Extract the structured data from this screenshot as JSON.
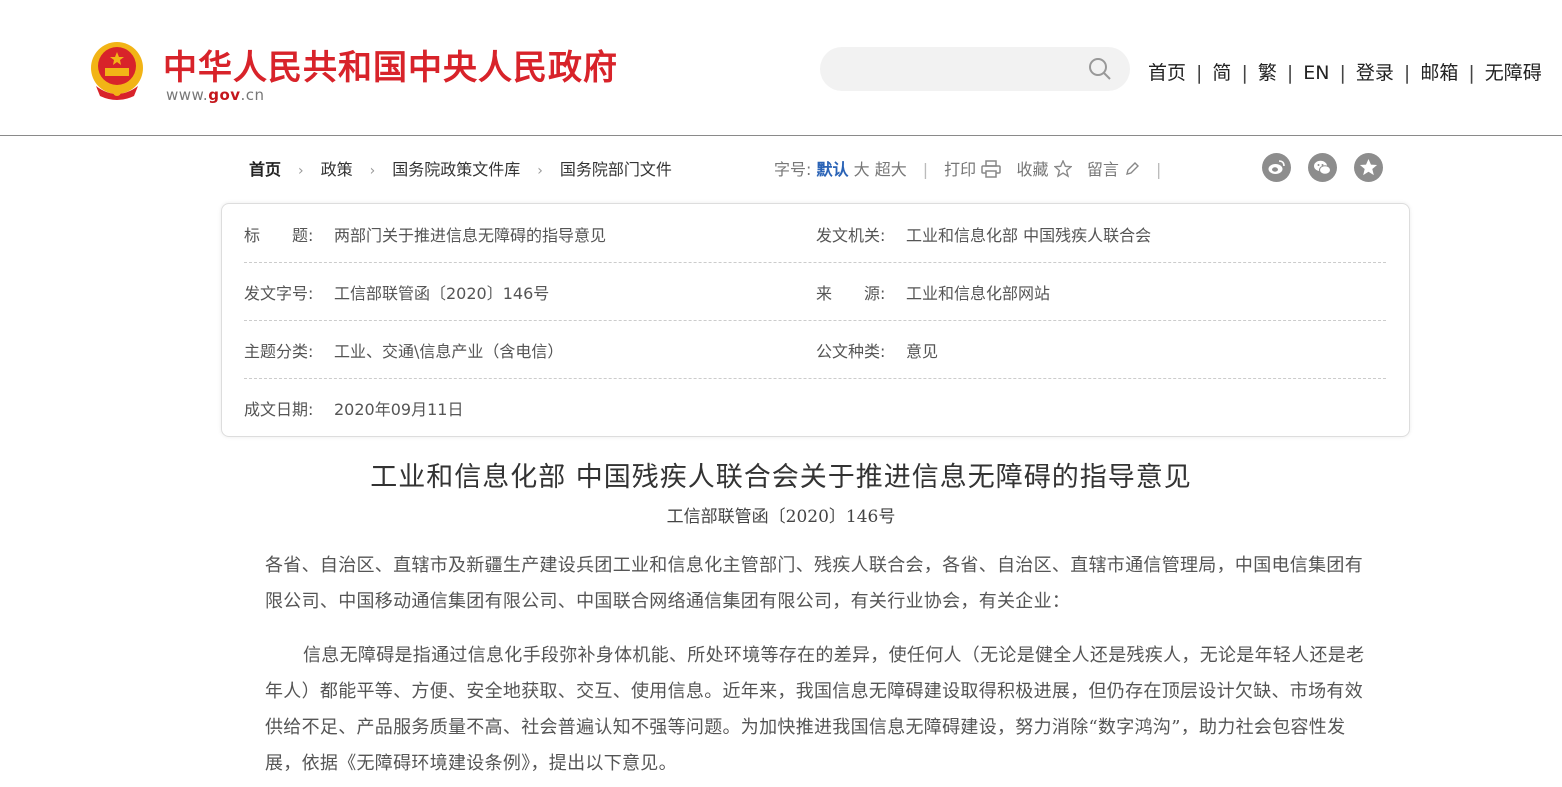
{
  "header": {
    "site_title": "中华人民共和国中央人民政府",
    "site_url_prefix": "www.",
    "site_url_mid": "gov",
    "site_url_suffix": ".cn",
    "search_placeholder": "",
    "nav": [
      "首页",
      "简",
      "繁",
      "EN",
      "登录",
      "邮箱",
      "无障碍"
    ],
    "nav_separator": "|"
  },
  "breadcrumb": {
    "items": [
      "首页",
      "政策",
      "国务院政策文件库",
      "国务院部门文件"
    ],
    "arrow": "›"
  },
  "toolbar": {
    "font_size_label": "字号:",
    "font_default": "默认",
    "font_large": "大",
    "font_xlarge": "超大",
    "print": "打印",
    "favorite": "收藏",
    "comment": "留言",
    "separator": "|",
    "share_icons": [
      "weibo-icon",
      "wechat-icon",
      "qzone-icon"
    ]
  },
  "info": {
    "title_label": "标　　题:",
    "title_value": "两部门关于推进信息无障碍的指导意见",
    "issuer_label": "发文机关:",
    "issuer_value": "工业和信息化部  中国残疾人联合会",
    "docno_label": "发文字号:",
    "docno_value": "工信部联管函〔2020〕146号",
    "source_label": "来　　源:",
    "source_value": "工业和信息化部网站",
    "topic_label": "主题分类:",
    "topic_value": "工业、交通\\信息产业（含电信）",
    "type_label": "公文种类:",
    "type_value": "意见",
    "date_label": "成文日期:",
    "date_value": "2020年09月11日"
  },
  "article": {
    "title": "工业和信息化部  中国残疾人联合会关于推进信息无障碍的指导意见",
    "subtitle": "工信部联管函〔2020〕146号",
    "para1": "各省、自治区、直辖市及新疆生产建设兵团工业和信息化主管部门、残疾人联合会，各省、自治区、直辖市通信管理局，中国电信集团有限公司、中国移动通信集团有限公司、中国联合网络通信集团有限公司，有关行业协会，有关企业：",
    "para2": "信息无障碍是指通过信息化手段弥补身体机能、所处环境等存在的差异，使任何人（无论是健全人还是残疾人，无论是年轻人还是老年人）都能平等、方便、安全地获取、交互、使用信息。近年来，我国信息无障碍建设取得积极进展，但仍存在顶层设计欠缺、市场有效供给不足、产品服务质量不高、社会普遍认知不强等问题。为加快推进我国信息无障碍建设，努力消除“数字鸿沟”，助力社会包容性发展，依据《无障碍环境建设条例》，提出以下意见。"
  },
  "colors": {
    "brand_red": "#d8232a",
    "link_blue": "#2a63b6",
    "emblem_gold": "#f2b416"
  }
}
